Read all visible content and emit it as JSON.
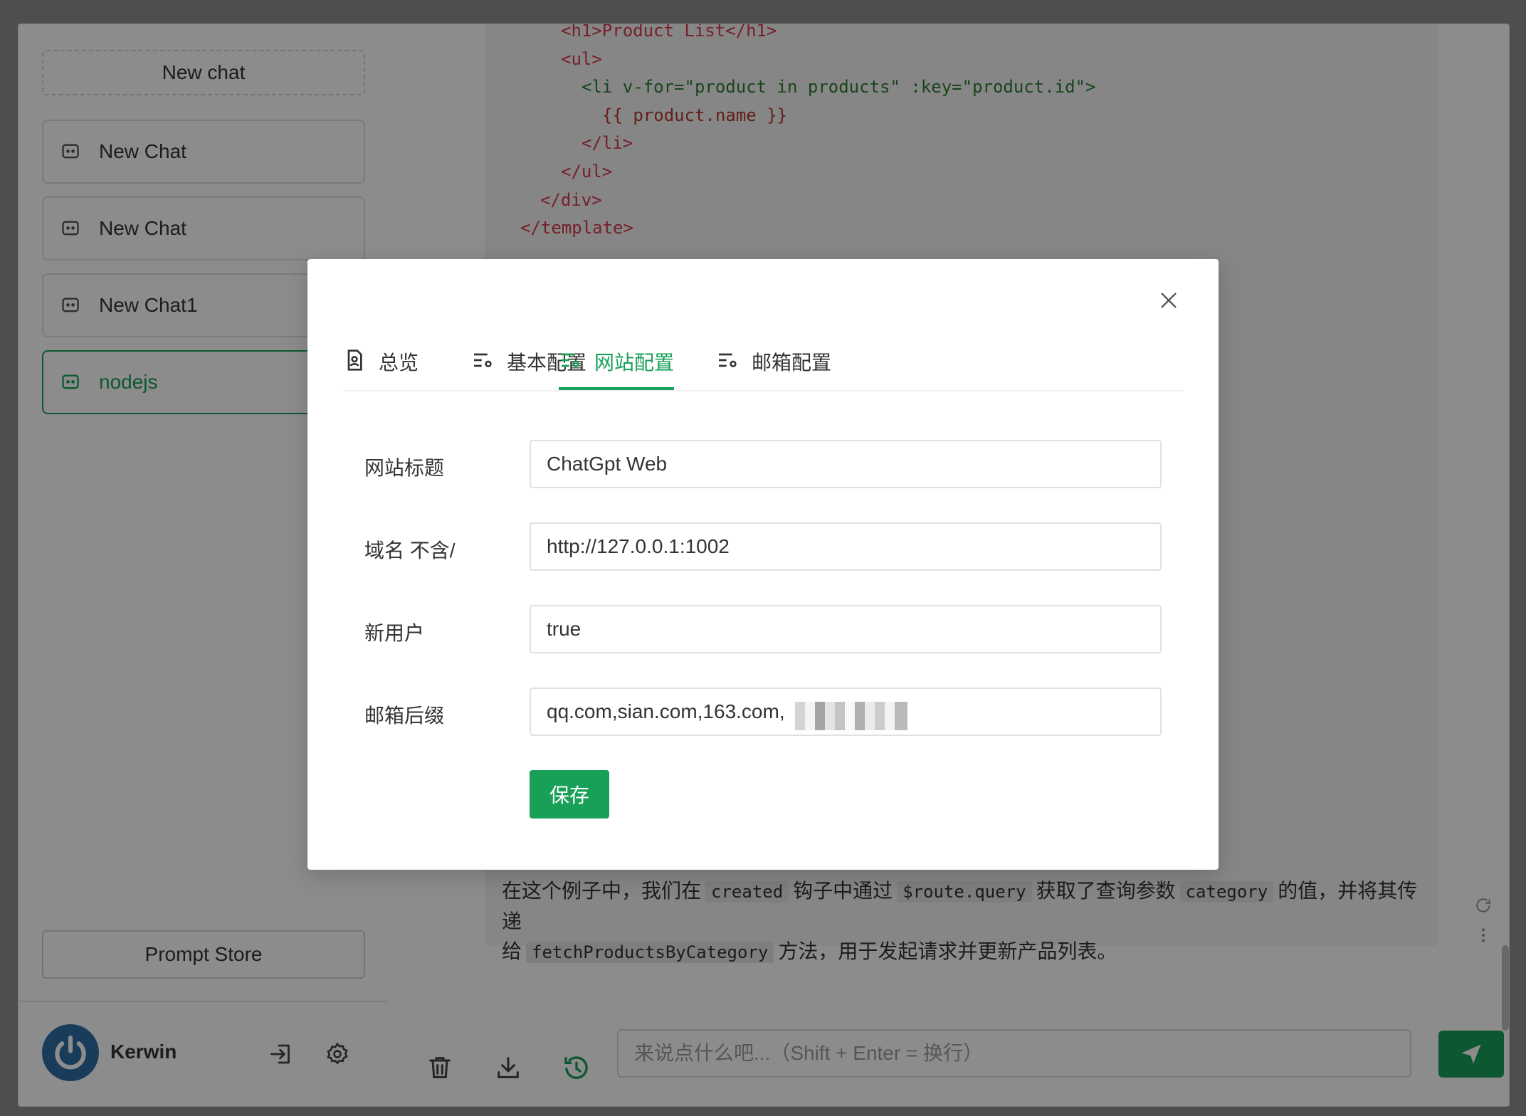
{
  "sidebar": {
    "new_chat_label": "New chat",
    "items": [
      {
        "label": "New Chat"
      },
      {
        "label": "New Chat"
      },
      {
        "label": "New Chat1"
      },
      {
        "label": "nodejs"
      }
    ],
    "prompt_store_label": "Prompt Store",
    "user": {
      "name": "Kerwin"
    }
  },
  "main": {
    "code_lines": [
      "<h1>Product List</h1>",
      "<ul>",
      "<li v-for=\"product in products\" :key=\"product.id\">",
      "{{ product.name }}",
      "</li>",
      "</ul>",
      "</div>",
      "</template>"
    ],
    "answer": {
      "t1": "在这个例子中，我们在",
      "c1": "created",
      "t2": "钩子中通过",
      "c2": "$route.query",
      "t3": "获取了查询参数",
      "c3": "category",
      "t4": "的值，并将其传递",
      "t5": "给",
      "c4": "fetchProductsByCategory",
      "t6": "方法，用于发起请求并更新产品列表。"
    },
    "input_placeholder": "来说点什么吧...（Shift + Enter = 换行）"
  },
  "modal": {
    "tabs": [
      {
        "label": "总览"
      },
      {
        "label": "基本配置"
      },
      {
        "label": "网站配置"
      },
      {
        "label": "邮箱配置"
      }
    ],
    "active_tab": "网站配置",
    "fields": [
      {
        "label": "网站标题",
        "value": "ChatGpt Web"
      },
      {
        "label": "域名 不含/",
        "value": "http://127.0.0.1:1002"
      },
      {
        "label": "新用户",
        "value": "true"
      },
      {
        "label": "邮箱后缀",
        "value": "qq.com,sian.com,163.com,"
      }
    ],
    "save_label": "保存"
  },
  "colors": {
    "accent": "#18a058",
    "overlay": "rgba(0,0,0,0.45)",
    "avatar": "#2f6ea5"
  }
}
